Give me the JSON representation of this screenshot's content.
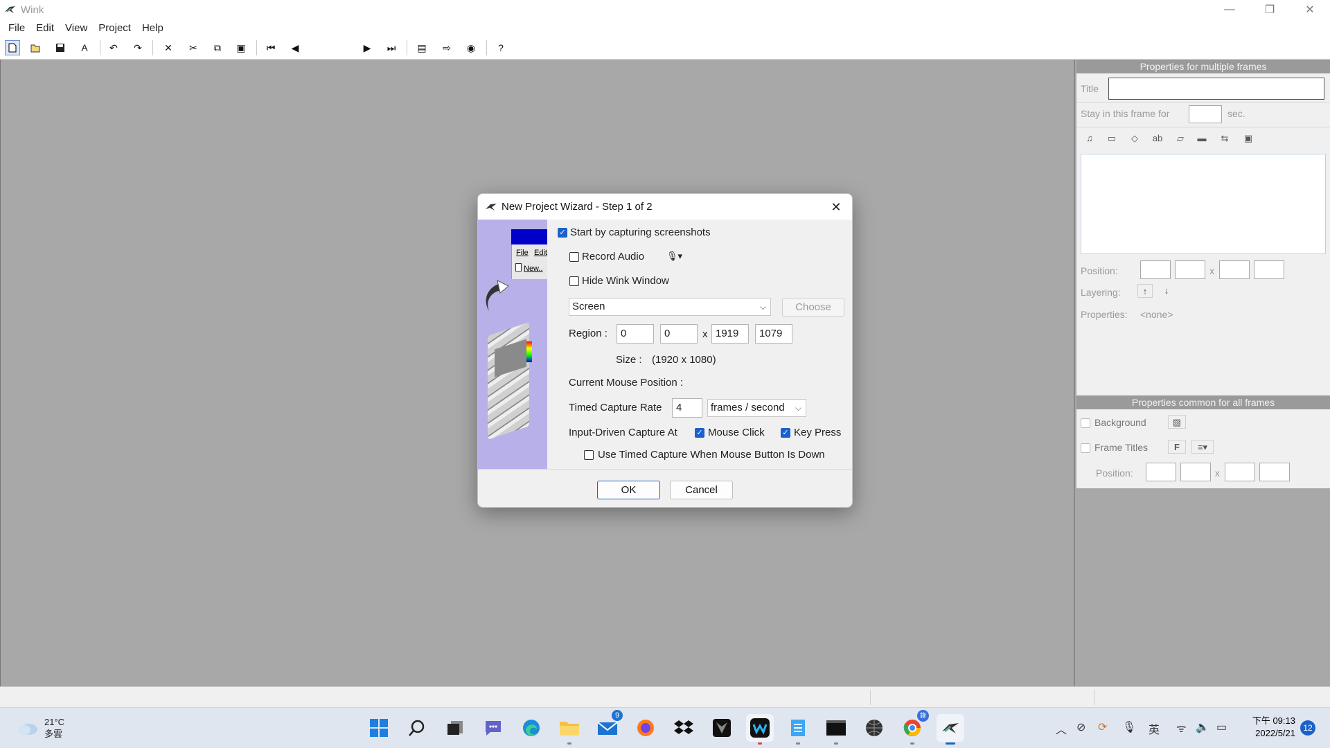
{
  "window": {
    "title": "Wink",
    "minimize": "—",
    "restore": "❐",
    "close": "✕"
  },
  "menu": [
    "File",
    "Edit",
    "View",
    "Project",
    "Help"
  ],
  "toolbar": {
    "icons": [
      "new-icon",
      "open-icon",
      "save-icon",
      "render-icon",
      "undo-icon",
      "redo-icon",
      "delete-icon",
      "cut-icon",
      "copy-icon",
      "paste-icon",
      "first-frame-icon",
      "prev-frame-icon",
      "next-frame-icon",
      "last-frame-icon",
      "page-icon",
      "forward-icon",
      "browser-icon",
      "help-icon"
    ]
  },
  "dialog": {
    "title": "New Project Wizard - Step 1 of 2",
    "close": "✕",
    "start_capturing": "Start by capturing screenshots",
    "start_capturing_checked": true,
    "record_audio": "Record Audio",
    "record_audio_checked": false,
    "mic_icon": "🎙",
    "hide_window": "Hide Wink Window",
    "hide_window_checked": false,
    "source_select": "Screen",
    "choose_button": "Choose",
    "region_label": "Region :",
    "region_x": "0",
    "region_y": "0",
    "region_sep": "x",
    "region_w": "1919",
    "region_h": "1079",
    "size_label": "Size :",
    "size_value": "(1920 x 1080)",
    "mouse_pos_label": "Current Mouse Position :",
    "timed_rate_label": "Timed Capture Rate",
    "timed_rate_value": "4",
    "rate_unit": "frames / second",
    "input_driven_label": "Input-Driven Capture At",
    "mouse_click": "Mouse Click",
    "mouse_click_checked": true,
    "key_press": "Key Press",
    "key_press_checked": true,
    "use_timed": "Use Timed Capture When Mouse Button Is Down",
    "use_timed_checked": false,
    "ok": "OK",
    "cancel": "Cancel",
    "preview": {
      "file": "File",
      "edit": "Edit",
      "new": "New.."
    }
  },
  "rightpanel": {
    "multi_header": "Properties for multiple frames",
    "title_label": "Title",
    "stay_label": "Stay in this frame for",
    "sec_label": "sec.",
    "position_label": "Position:",
    "x_sep": "x",
    "layering_label": "Layering:",
    "layer_up": "↑",
    "layer_down": "↓",
    "properties_label": "Properties:",
    "properties_value": "<none>",
    "common_header": "Properties common for all frames",
    "background_label": "Background",
    "frame_titles_label": "Frame Titles",
    "frame_titles_font": "F",
    "position2_label": "Position:"
  },
  "taskbar": {
    "temp": "21°C",
    "weather_text": "多雲",
    "apps": [
      "start-icon",
      "search-icon",
      "task-view-icon",
      "chat-icon",
      "edge-icon",
      "file-explorer-icon",
      "mail-icon",
      "firefox-icon",
      "dropbox-icon",
      "predator-icon",
      "webex-icon",
      "notepad-icon",
      "terminal-icon",
      "sphere-app-icon",
      "chrome-icon",
      "wink-icon"
    ],
    "mail_badge": "9",
    "chrome_badge": "錄",
    "ime": "英",
    "time": "下午 09:13",
    "date": "2022/5/21",
    "notif_count": "12"
  }
}
